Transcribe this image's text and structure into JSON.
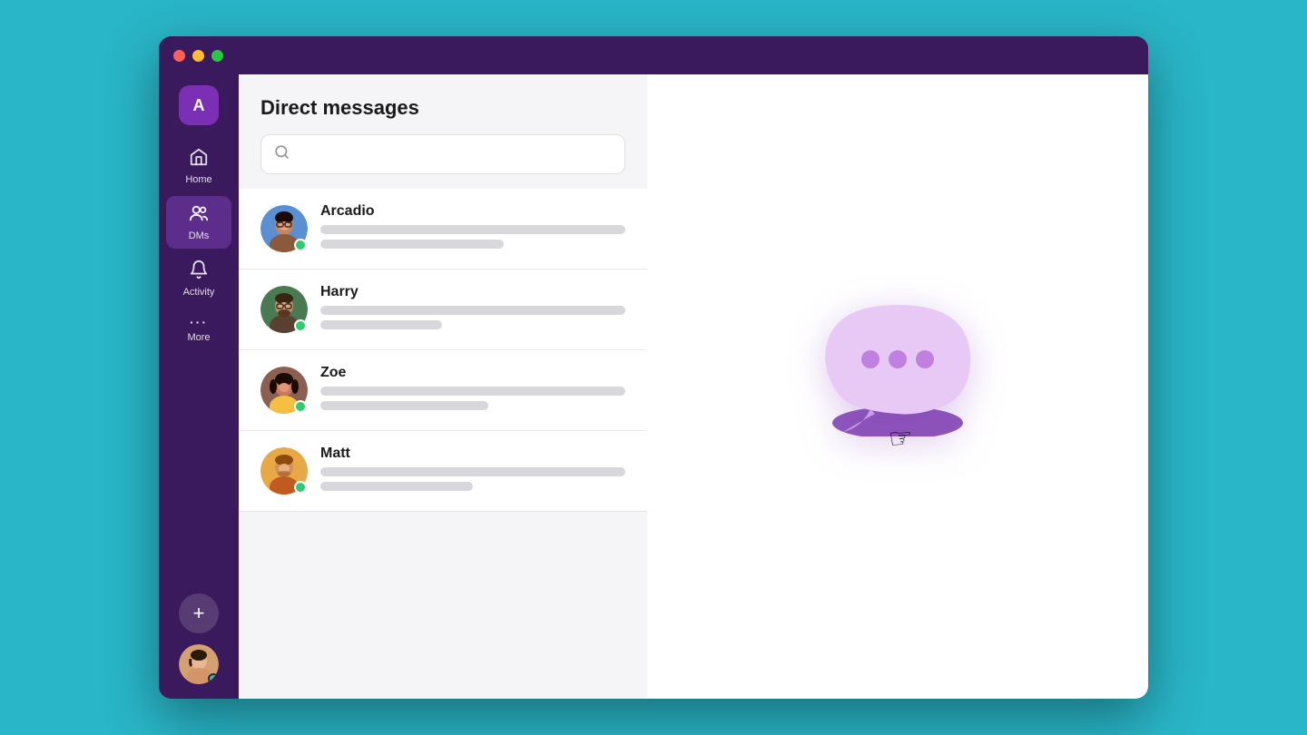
{
  "window": {
    "title": "Direct messages",
    "traffic_lights": [
      "close",
      "minimize",
      "maximize"
    ]
  },
  "sidebar": {
    "user_initial": "A",
    "items": [
      {
        "id": "home",
        "label": "Home",
        "icon": "⌂",
        "active": false
      },
      {
        "id": "dms",
        "label": "DMs",
        "icon": "👥",
        "active": true
      },
      {
        "id": "activity",
        "label": "Activity",
        "icon": "🔔",
        "active": false
      },
      {
        "id": "more",
        "label": "More",
        "icon": "···",
        "active": false
      }
    ],
    "add_button_label": "+",
    "status_color": "#2ecc71"
  },
  "dm_panel": {
    "title": "Direct messages",
    "search_placeholder": "",
    "contacts": [
      {
        "id": "arcadio",
        "name": "Arcadio",
        "online": true
      },
      {
        "id": "harry",
        "name": "Harry",
        "online": true
      },
      {
        "id": "zoe",
        "name": "Zoe",
        "online": true
      },
      {
        "id": "matt",
        "name": "Matt",
        "online": true
      }
    ]
  },
  "chat_area": {
    "empty": true
  }
}
